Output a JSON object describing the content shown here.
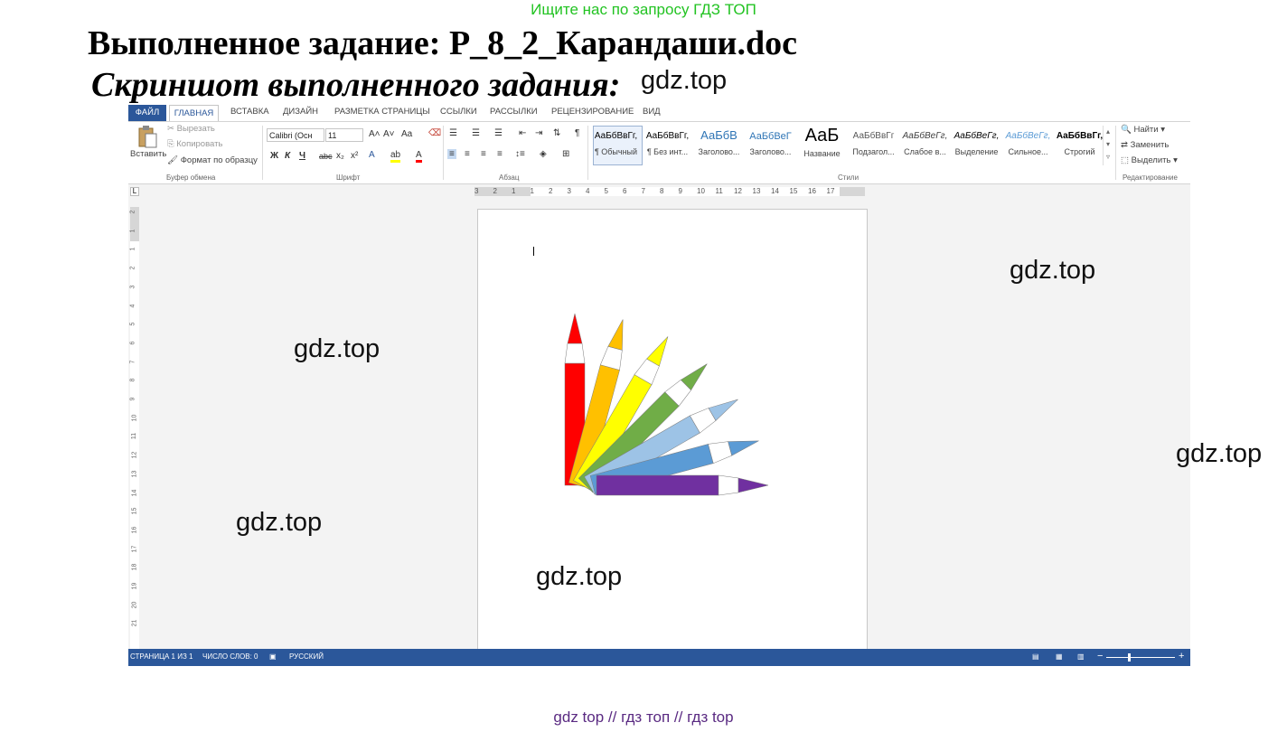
{
  "promo": "Ищите нас по запросу ГДЗ ТОП",
  "title": "Выполненное задание: Р_8_2_Карандаши.doc",
  "subtitle": "Скриншот выполненного задания:",
  "watermark": "gdz.top",
  "footer": "gdz top  //  гдз топ  //  гдз top",
  "word": {
    "tabs": [
      "ФАЙЛ",
      "ГЛАВНАЯ",
      "ВСТАВКА",
      "ДИЗАЙН",
      "РАЗМЕТКА СТРАНИЦЫ",
      "ССЫЛКИ",
      "РАССЫЛКИ",
      "РЕЦЕНЗИРОВАНИЕ",
      "ВИД"
    ],
    "clipboard": {
      "paste": "Вставить",
      "cut": "Вырезать",
      "copy": "Копировать",
      "format_painter": "Формат по образцу",
      "group": "Буфер обмена"
    },
    "font": {
      "name": "Calibri (Осн",
      "size": "11",
      "group": "Шрифт",
      "bold": "Ж",
      "italic": "К",
      "underline": "Ч",
      "strike": "abc",
      "subscript": "x₂",
      "superscript": "x²",
      "grow": "A˄",
      "shrink": "A˅",
      "case": "Aa",
      "color": "A"
    },
    "paragraph": {
      "group": "Абзац"
    },
    "styles": {
      "group": "Стили",
      "items": [
        {
          "preview": "АаБбВвГг,",
          "name": "¶ Обычный"
        },
        {
          "preview": "АаБбВвГг,",
          "name": "¶ Без инт..."
        },
        {
          "preview": "АаБбВ",
          "name": "Заголово..."
        },
        {
          "preview": "АаБбВеГ",
          "name": "Заголово..."
        },
        {
          "preview": "АаБ",
          "name": "Название"
        },
        {
          "preview": "АаБбВвГг",
          "name": "Подзагол..."
        },
        {
          "preview": "АаБбВеГг,",
          "name": "Слабое в..."
        },
        {
          "preview": "АаБбВеГг,",
          "name": "Выделение"
        },
        {
          "preview": "АаБбВеГг,",
          "name": "Сильное..."
        },
        {
          "preview": "АаБбВвГг,",
          "name": "Строгий"
        }
      ]
    },
    "editing": {
      "find": "Найти",
      "replace": "Заменить",
      "select": "Выделить",
      "group": "Редактирование"
    },
    "ruler_h": [
      "3",
      "2",
      "1",
      "1",
      "2",
      "3",
      "4",
      "5",
      "6",
      "7",
      "8",
      "9",
      "10",
      "11",
      "12",
      "13",
      "14",
      "15",
      "16",
      "17"
    ],
    "ruler_v": [
      "2",
      "1",
      "1",
      "2",
      "3",
      "4",
      "5",
      "6",
      "7",
      "8",
      "9",
      "10",
      "11",
      "12",
      "13",
      "14",
      "15",
      "16",
      "17",
      "18",
      "19",
      "20",
      "21"
    ],
    "status": {
      "page": "СТРАНИЦА 1 ИЗ 1",
      "words": "ЧИСЛО СЛОВ: 0",
      "lang": "РУССКИЙ"
    },
    "pencil_colors": [
      "#ff0000",
      "#ffc000",
      "#ffff00",
      "#70ad47",
      "#9dc3e6",
      "#5b9bd5",
      "#7030a0"
    ]
  }
}
